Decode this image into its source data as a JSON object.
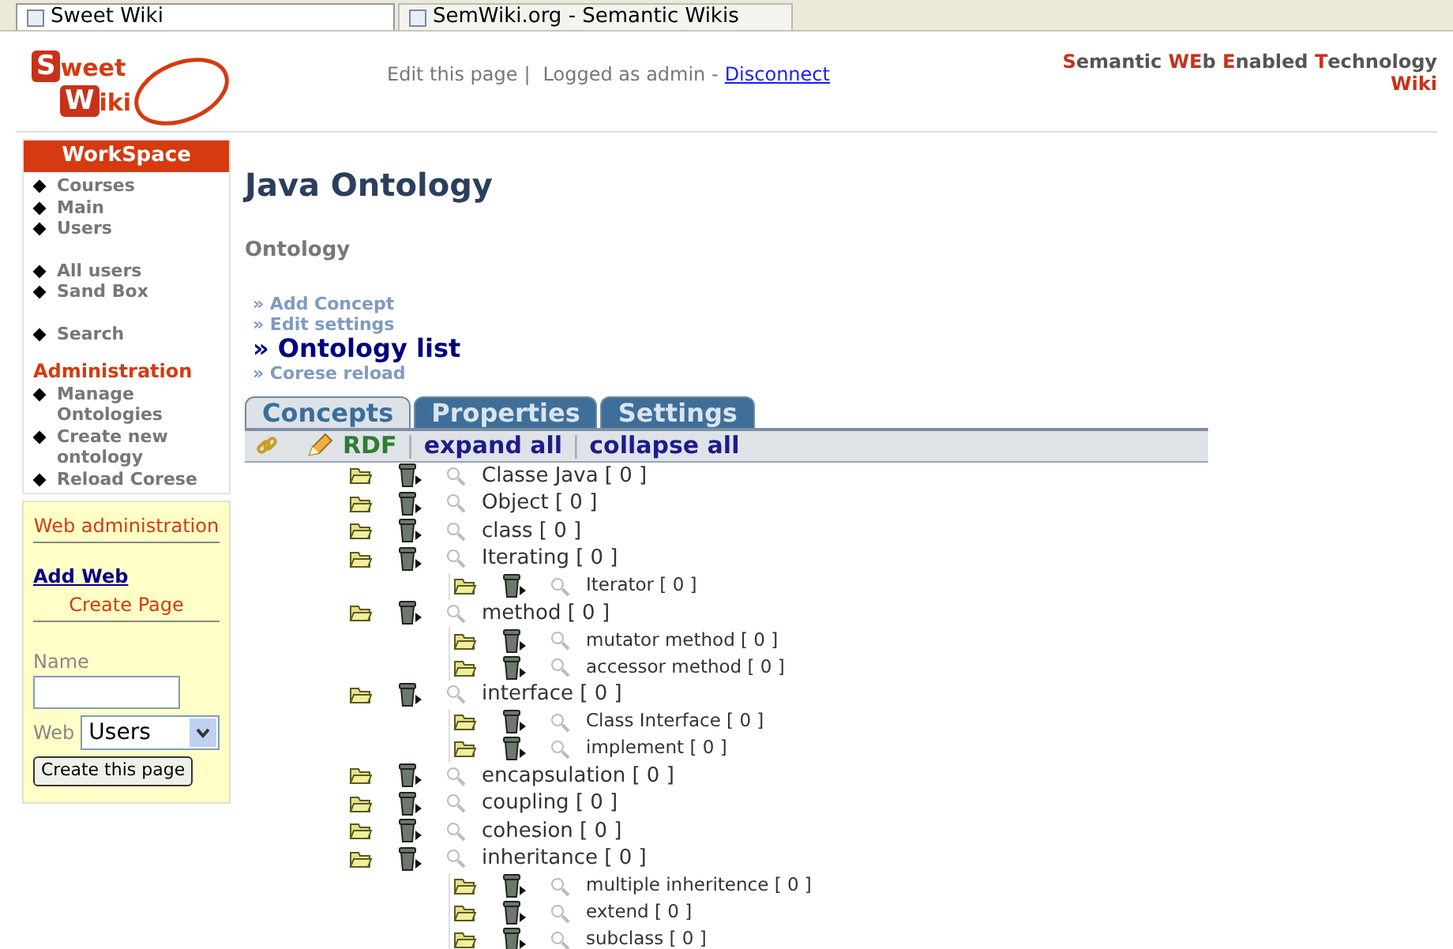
{
  "browser_tabs": [
    {
      "label": "Sweet Wiki",
      "selected": true
    },
    {
      "label": "SemWiki.org - Semantic Wikis",
      "selected": false
    }
  ],
  "logo": {
    "line_1": "Sweet",
    "line_2": "Wiki"
  },
  "header": {
    "edit": "Edit this page",
    "separator": "|",
    "logged": "Logged as admin -",
    "disconnect": "Disconnect",
    "tagline": "**S**emantic **WE**b **E**nabled **T**echnology **Wiki**"
  },
  "workspace": {
    "title": "WorkSpace",
    "groups": [
      [
        "Courses",
        "Main",
        "Users"
      ],
      [
        "All users",
        "Sand Box"
      ],
      [
        "Search"
      ]
    ]
  },
  "administration": {
    "title": "Administration",
    "items": [
      "Manage Ontologies",
      "Create new ontology",
      "Reload Corese"
    ]
  },
  "web_admin": {
    "title": "Web administration",
    "add_web": "Add Web",
    "create_page": "Create Page",
    "name_label": "Name",
    "web_label": "Web",
    "web_value": "Users",
    "button": "Create this page"
  },
  "page": {
    "title": "Java Ontology",
    "subtitle": "Ontology",
    "links": [
      {
        "label": "» Add Concept",
        "selected": false
      },
      {
        "label": "» Edit settings",
        "selected": false
      },
      {
        "label": "» Ontology list",
        "selected": true
      },
      {
        "label": "» Corese reload",
        "selected": false
      }
    ]
  },
  "tabs": [
    {
      "label": "Concepts",
      "selected": true
    },
    {
      "label": "Properties",
      "selected": false
    },
    {
      "label": "Settings",
      "selected": false
    }
  ],
  "toolbar": {
    "rdf": "RDF",
    "sep_1": "|",
    "expand": "expand all",
    "sep_2": "|",
    "collapse": "collapse all"
  },
  "tree": [
    {
      "label": "Classe Java [ 0 ]"
    },
    {
      "label": "Object [ 0 ]"
    },
    {
      "label": "class [ 0 ]"
    },
    {
      "label": "Iterating [ 0 ]",
      "children": [
        {
          "label": "Iterator [ 0 ]"
        }
      ]
    },
    {
      "label": "method [ 0 ]",
      "children": [
        {
          "label": "mutator method [ 0 ]"
        },
        {
          "label": "accessor method [ 0 ]"
        }
      ]
    },
    {
      "label": "interface [ 0 ]",
      "children": [
        {
          "label": "Class Interface [ 0 ]"
        },
        {
          "label": "implement [ 0 ]"
        }
      ]
    },
    {
      "label": "encapsulation [ 0 ]"
    },
    {
      "label": "coupling [ 0 ]"
    },
    {
      "label": "cohesion [ 0 ]"
    },
    {
      "label": "inheritance [ 0 ]",
      "children": [
        {
          "label": "multiple inheritence [ 0 ]"
        },
        {
          "label": "extend [ 0 ]"
        },
        {
          "label": "subclass [ 0 ]"
        }
      ]
    }
  ]
}
